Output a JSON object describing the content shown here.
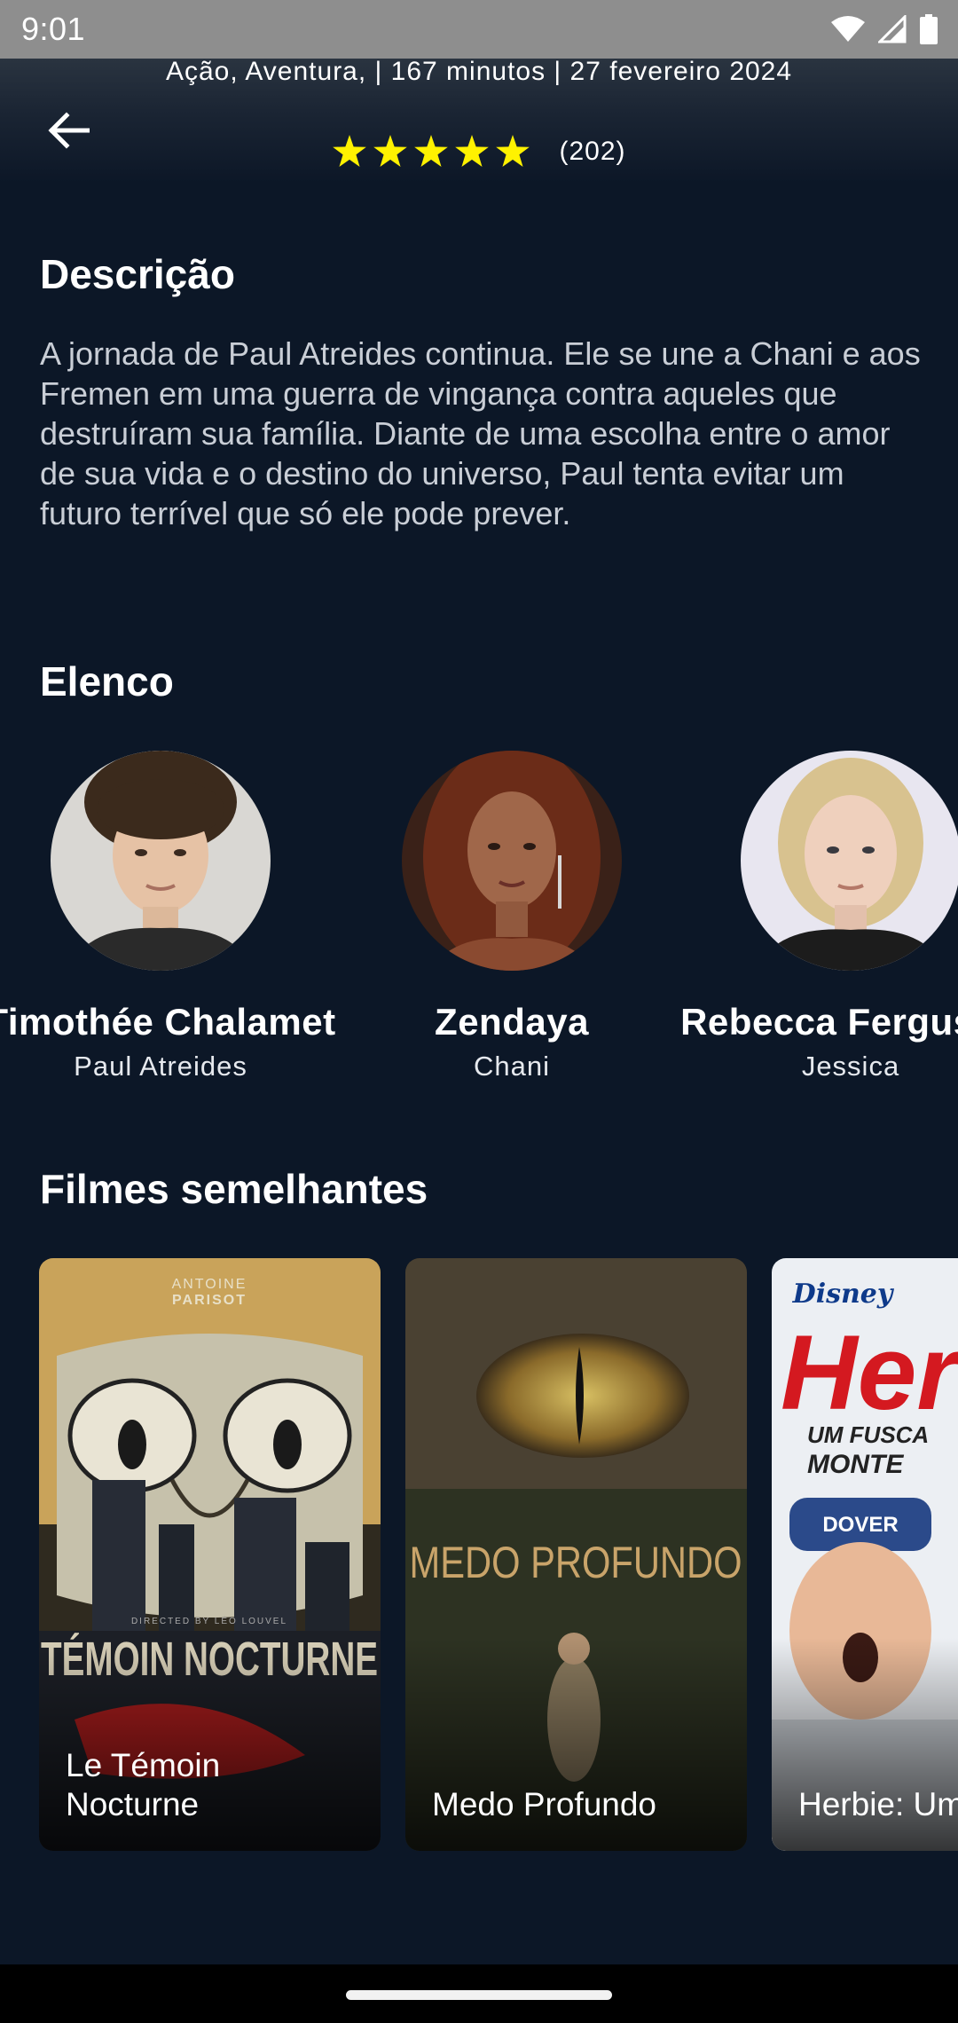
{
  "status_bar": {
    "time": "9:01"
  },
  "header": {
    "meta": "Ação, Aventura, | 167 minutos | 27 fevereiro 2024",
    "rating_stars": 5,
    "rating_count": "(202)"
  },
  "description": {
    "title": "Descrição",
    "text": "A jornada de Paul Atreides continua. Ele se une a Chani e aos Fremen em uma guerra de vingança contra aqueles que destruíram sua família. Diante de uma escolha entre o amor de sua vida e o destino do universo, Paul tenta evitar um futuro terrível que só ele pode prever."
  },
  "cast": {
    "title": "Elenco",
    "members": [
      {
        "name": "Timothée Chalamet",
        "role": "Paul Atreides"
      },
      {
        "name": "Zendaya",
        "role": "Chani"
      },
      {
        "name": "Rebecca Ferguson",
        "role": "Jessica"
      }
    ]
  },
  "similar": {
    "title": "Filmes semelhantes",
    "movies": [
      {
        "title": "Le Témoin\nNocturne",
        "poster_top": "ANTOINE\nPARISOT",
        "poster_credit": "DIRECTED BY LÉO LOUVEL",
        "poster_title": "TÉMOIN NOCTURNE"
      },
      {
        "title": "Medo Profundo",
        "poster_title": "MEDO PROFUNDO"
      },
      {
        "title": "Herbie: Um Fusca\nem Monte Carlo",
        "poster_top": "Disney",
        "poster_title": "Herbie",
        "poster_subtitle": "UM FUSCA EM MONTE CARLO",
        "poster_badge": "DOVER"
      }
    ]
  },
  "colors": {
    "background": "#0c1727",
    "star": "#fff200",
    "description_text": "#c9ced6",
    "status_bar": "#8e8e8e"
  }
}
